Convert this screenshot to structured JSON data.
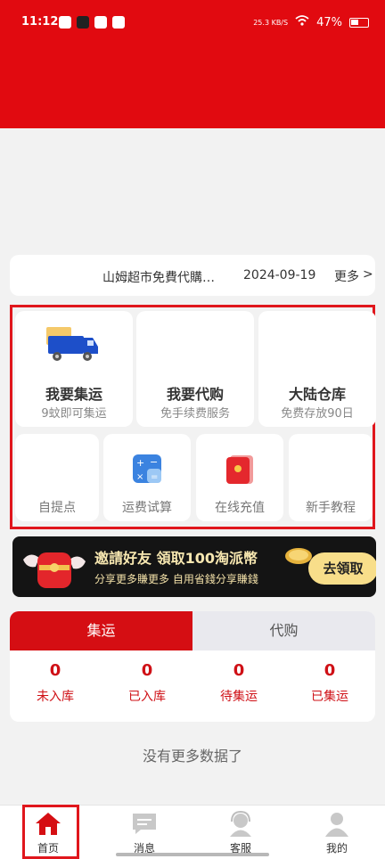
{
  "status_bar": {
    "time": "11:12",
    "signal_text": "25.3 KB/S",
    "battery": "47%"
  },
  "news": {
    "title": "山姆超市免費代購…",
    "date": "2024-09-19",
    "more_label": "更多",
    "more_arrow": ">"
  },
  "services": {
    "big": [
      {
        "title": "我要集运",
        "subtitle": "9蚊即可集运",
        "icon": "truck-icon"
      },
      {
        "title": "我要代购",
        "subtitle": "免手续费服务",
        "icon": ""
      },
      {
        "title": "大陆仓库",
        "subtitle": "免费存放90日",
        "icon": ""
      }
    ],
    "small": [
      {
        "label": "自提点",
        "icon": ""
      },
      {
        "label": "运费试算",
        "icon": "calculator-icon"
      },
      {
        "label": "在线充值",
        "icon": "red-envelope-icon"
      },
      {
        "label": "新手教程",
        "icon": ""
      }
    ]
  },
  "banner": {
    "title": "邀請好友 領取100淘派幣",
    "subtitle": "分享更多賺更多 自用省錢分享賺錢",
    "button_label": "去領取"
  },
  "shipping": {
    "tabs": [
      "集运",
      "代购"
    ],
    "active_tab": "集运",
    "stats": [
      {
        "value": "0",
        "label": "未入库"
      },
      {
        "value": "0",
        "label": "已入库"
      },
      {
        "value": "0",
        "label": "待集运"
      },
      {
        "value": "0",
        "label": "已集运"
      }
    ]
  },
  "empty_message": "没有更多数据了",
  "tabbar": {
    "items": [
      {
        "label": "首页",
        "icon": "home-icon",
        "active": true
      },
      {
        "label": "消息",
        "icon": "message-icon",
        "active": false
      },
      {
        "label": "客服",
        "icon": "support-icon",
        "active": false
      },
      {
        "label": "我的",
        "icon": "profile-icon",
        "active": false
      }
    ]
  },
  "colors": {
    "brand_red": "#e10a10",
    "accent_gold": "#f8de8a"
  }
}
